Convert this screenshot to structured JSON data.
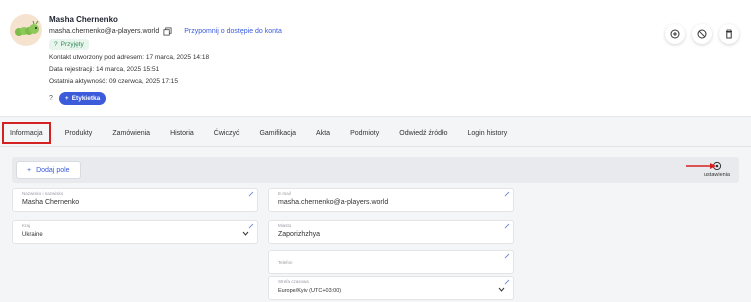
{
  "contact": {
    "name": "Masha Chernenko",
    "email": "masha.chernenko@a-players.world",
    "remind_link": "Przypomnij o dostępie do konta",
    "status": "Przyjęty",
    "created_label": "Kontakt utworzony pod adresem:",
    "created_value": "17 marca, 2025 14:18",
    "registered_label": "Data rejestracji:",
    "registered_value": "14 marca, 2025 15:51",
    "last_active_label": "Ostatnia aktywność:",
    "last_active_value": "09 czerwca, 2025 17:15",
    "question_mark": "?",
    "tag_button": "Etykietka"
  },
  "actions": [
    {
      "icon": "add-circle-icon"
    },
    {
      "icon": "block-icon"
    },
    {
      "icon": "trash-icon"
    }
  ],
  "tabs": [
    {
      "label": "Informacja",
      "active": true
    },
    {
      "label": "Produkty"
    },
    {
      "label": "Zamówienia"
    },
    {
      "label": "Historia"
    },
    {
      "label": "Ćwiczyć"
    },
    {
      "label": "Gamifikacja"
    },
    {
      "label": "Akta"
    },
    {
      "label": "Podmioty"
    },
    {
      "label": "Odwiedź źródło"
    },
    {
      "label": "Login history"
    }
  ],
  "settings_bar": {
    "add_field": "Dodaj pole",
    "settings_label": "ustawienia"
  },
  "fields": {
    "name_label": "Nazwisko i nazwisko",
    "name_value": "Masha Chernenko",
    "email_label": "E-mail",
    "email_value": "masha.chernenko@a-players.world",
    "country_label": "Kraj",
    "country_value": "Ukraine",
    "city_label": "Miasto",
    "city_value": "Zaporizhzhya",
    "phone_label": "Telefon",
    "timezone_label": "Strefa czasowa",
    "timezone_value": "Europe/Kyiv (UTC+03:00)"
  },
  "colors": {
    "accent": "#3b5bdb",
    "highlight": "#d42121",
    "status_green": "#2e8b57"
  }
}
